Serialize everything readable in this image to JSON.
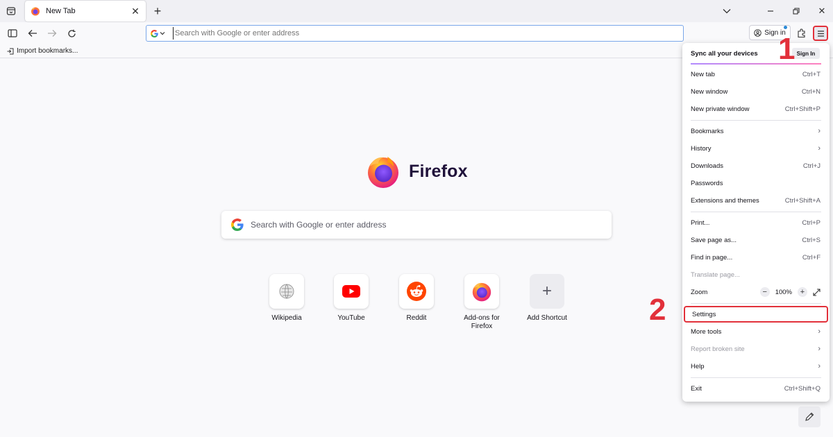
{
  "tab": {
    "title": "New Tab"
  },
  "urlbar": {
    "placeholder": "Search with Google or enter address"
  },
  "toolbar": {
    "signin_label": "Sign in"
  },
  "bookmarks": {
    "import_label": "Import bookmarks..."
  },
  "content": {
    "logo_text": "Firefox",
    "search_placeholder": "Search with Google or enter address",
    "shortcuts": [
      {
        "label": "Wikipedia"
      },
      {
        "label": "YouTube"
      },
      {
        "label": "Reddit"
      },
      {
        "label": "Add-ons for Firefox"
      },
      {
        "label": "Add Shortcut"
      }
    ]
  },
  "menu": {
    "sync_title": "Sync all your devices",
    "sync_button": "Sign In",
    "items": [
      {
        "label": "New tab",
        "shortcut": "Ctrl+T"
      },
      {
        "label": "New window",
        "shortcut": "Ctrl+N"
      },
      {
        "label": "New private window",
        "shortcut": "Ctrl+Shift+P"
      },
      {
        "label": "Bookmarks",
        "shortcut": ""
      },
      {
        "label": "History",
        "shortcut": ""
      },
      {
        "label": "Downloads",
        "shortcut": "Ctrl+J"
      },
      {
        "label": "Passwords",
        "shortcut": ""
      },
      {
        "label": "Extensions and themes",
        "shortcut": "Ctrl+Shift+A"
      },
      {
        "label": "Print...",
        "shortcut": "Ctrl+P"
      },
      {
        "label": "Save page as...",
        "shortcut": "Ctrl+S"
      },
      {
        "label": "Find in page...",
        "shortcut": "Ctrl+F"
      },
      {
        "label": "Translate page...",
        "shortcut": ""
      },
      {
        "label": "Zoom",
        "shortcut": ""
      },
      {
        "label": "Settings",
        "shortcut": ""
      },
      {
        "label": "More tools",
        "shortcut": ""
      },
      {
        "label": "Report broken site",
        "shortcut": ""
      },
      {
        "label": "Help",
        "shortcut": ""
      },
      {
        "label": "Exit",
        "shortcut": "Ctrl+Shift+Q"
      }
    ],
    "zoom": {
      "value": "100%",
      "minus": "−",
      "plus": "+"
    }
  },
  "annotations": {
    "step1": "1",
    "step2": "2"
  },
  "colors": {
    "accent": "#e2303a",
    "focus": "#7aa7e9",
    "firefox_purple": "#20123a"
  }
}
